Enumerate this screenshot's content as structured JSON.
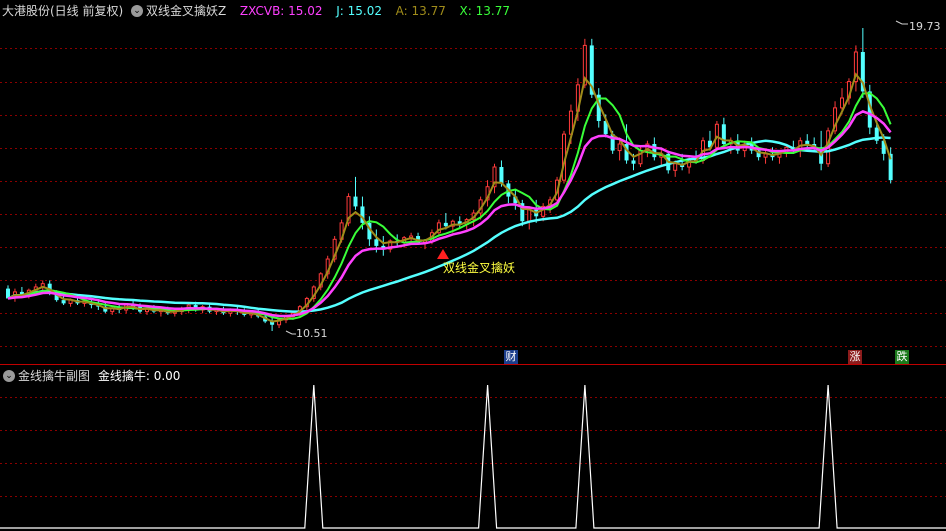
{
  "header": {
    "stock_name": "大港股份(日线 前复权)",
    "indicator_name": "双线金叉擒妖Z",
    "zxcvb_label": "ZXCVB:",
    "zxcvb_value": "15.02",
    "j_label": "J:",
    "j_value": "15.02",
    "a_label": "A:",
    "a_value": "13.77",
    "x_label": "X:",
    "x_value": "13.77",
    "toggle_icon": "chevron-down-icon"
  },
  "sub_header": {
    "indicator_name": "金线擒牛副图",
    "line_label": "金线擒牛:",
    "line_value": "0.00",
    "toggle_icon": "chevron-down-icon"
  },
  "annotations": {
    "high_price": "19.73",
    "low_price": "10.51",
    "signal_text": "双线金叉擒妖",
    "marker_cai": "财",
    "marker_zhang": "涨",
    "marker_die": "跌"
  },
  "colors": {
    "background": "#000000",
    "grid": "#8b0000",
    "up_candle": "#ff3b3b",
    "down_candle": "#54ffff",
    "line_cyan": "#54ffff",
    "line_magenta": "#ff40ff",
    "line_green": "#39ff39",
    "line_olive": "#a08c1a",
    "signal_triangle": "#ff2020",
    "signal_text": "#ffff40",
    "zxcvb": "#ff40ff",
    "j": "#54ffff",
    "a": "#a08c1a",
    "x": "#39ff39",
    "sub_line": "#ffffff"
  },
  "chart_data": {
    "type": "candlestick",
    "price_high": 19.73,
    "price_low": 10.51,
    "candles": [
      [
        11.8,
        11.9,
        11.5,
        11.5
      ],
      [
        11.55,
        11.8,
        11.4,
        11.7
      ],
      [
        11.7,
        11.85,
        11.55,
        11.6
      ],
      [
        11.6,
        11.8,
        11.5,
        11.75
      ],
      [
        11.75,
        11.95,
        11.6,
        11.85
      ],
      [
        11.85,
        12.05,
        11.75,
        11.95
      ],
      [
        11.95,
        12.05,
        11.6,
        11.7
      ],
      [
        11.7,
        11.75,
        11.4,
        11.45
      ],
      [
        11.45,
        11.6,
        11.3,
        11.35
      ],
      [
        11.35,
        11.5,
        11.25,
        11.45
      ],
      [
        11.45,
        11.55,
        11.3,
        11.35
      ],
      [
        11.35,
        11.45,
        11.25,
        11.4
      ],
      [
        11.4,
        11.5,
        11.2,
        11.3
      ],
      [
        11.3,
        11.45,
        11.15,
        11.25
      ],
      [
        11.25,
        11.4,
        11.05,
        11.1
      ],
      [
        11.1,
        11.25,
        11.0,
        11.2
      ],
      [
        11.2,
        11.3,
        11.05,
        11.15
      ],
      [
        11.15,
        11.35,
        11.05,
        11.3
      ],
      [
        11.3,
        11.45,
        11.15,
        11.25
      ],
      [
        11.25,
        11.35,
        11.05,
        11.1
      ],
      [
        11.1,
        11.25,
        11.0,
        11.2
      ],
      [
        11.2,
        11.3,
        11.05,
        11.1
      ],
      [
        11.1,
        11.2,
        10.95,
        11.15
      ],
      [
        11.15,
        11.25,
        11.0,
        11.05
      ],
      [
        11.05,
        11.2,
        10.95,
        11.1
      ],
      [
        11.1,
        11.25,
        11.0,
        11.2
      ],
      [
        11.2,
        11.35,
        11.05,
        11.3
      ],
      [
        11.3,
        11.4,
        11.1,
        11.15
      ],
      [
        11.15,
        11.3,
        11.05,
        11.25
      ],
      [
        11.25,
        11.35,
        11.05,
        11.1
      ],
      [
        11.1,
        11.2,
        11.0,
        11.15
      ],
      [
        11.15,
        11.25,
        11.0,
        11.05
      ],
      [
        11.05,
        11.2,
        10.95,
        11.15
      ],
      [
        11.15,
        11.3,
        11.0,
        11.1
      ],
      [
        11.1,
        11.2,
        10.95,
        11.0
      ],
      [
        11.0,
        11.1,
        10.9,
        11.05
      ],
      [
        11.05,
        11.15,
        10.9,
        10.95
      ],
      [
        10.95,
        11.05,
        10.75,
        10.8
      ],
      [
        10.8,
        10.95,
        10.51,
        10.7
      ],
      [
        10.7,
        10.9,
        10.6,
        10.85
      ],
      [
        10.85,
        11.0,
        10.75,
        10.95
      ],
      [
        10.95,
        11.1,
        10.85,
        11.05
      ],
      [
        11.05,
        11.3,
        10.95,
        11.25
      ],
      [
        11.25,
        11.55,
        11.15,
        11.5
      ],
      [
        11.5,
        11.9,
        11.4,
        11.85
      ],
      [
        11.85,
        12.3,
        11.75,
        12.25
      ],
      [
        12.25,
        12.8,
        12.1,
        12.7
      ],
      [
        12.7,
        13.4,
        12.6,
        13.3
      ],
      [
        13.3,
        13.9,
        13.2,
        13.8
      ],
      [
        13.8,
        14.7,
        13.7,
        14.6
      ],
      [
        14.6,
        15.2,
        14.2,
        14.3
      ],
      [
        14.3,
        14.6,
        13.6,
        13.8
      ],
      [
        13.8,
        14.0,
        13.1,
        13.3
      ],
      [
        13.3,
        13.6,
        12.9,
        13.1
      ],
      [
        13.1,
        13.4,
        12.8,
        13.0
      ],
      [
        13.0,
        13.3,
        12.9,
        13.25
      ],
      [
        13.25,
        13.45,
        13.1,
        13.2
      ],
      [
        13.2,
        13.4,
        13.05,
        13.35
      ],
      [
        13.35,
        13.5,
        13.2,
        13.4
      ],
      [
        13.4,
        13.5,
        13.15,
        13.2
      ],
      [
        13.2,
        13.3,
        13.0,
        13.25
      ],
      [
        13.25,
        13.6,
        13.15,
        13.5
      ],
      [
        13.5,
        13.9,
        13.4,
        13.8
      ],
      [
        13.8,
        14.1,
        13.6,
        13.7
      ],
      [
        13.7,
        13.9,
        13.5,
        13.85
      ],
      [
        13.85,
        14.0,
        13.65,
        13.75
      ],
      [
        13.75,
        13.95,
        13.6,
        13.9
      ],
      [
        13.9,
        14.2,
        13.7,
        14.1
      ],
      [
        14.1,
        14.6,
        13.9,
        14.5
      ],
      [
        14.5,
        15.1,
        14.3,
        14.9
      ],
      [
        14.9,
        15.6,
        14.7,
        15.5
      ],
      [
        15.5,
        15.7,
        14.9,
        15.0
      ],
      [
        15.0,
        15.1,
        14.4,
        14.6
      ],
      [
        14.6,
        14.8,
        14.2,
        14.4
      ],
      [
        14.4,
        14.5,
        13.7,
        13.85
      ],
      [
        13.85,
        14.3,
        13.6,
        14.2
      ],
      [
        14.2,
        14.5,
        13.8,
        14.0
      ],
      [
        14.0,
        14.4,
        13.85,
        14.3
      ],
      [
        14.3,
        14.6,
        14.1,
        14.5
      ],
      [
        14.5,
        15.2,
        14.4,
        15.1
      ],
      [
        15.1,
        16.6,
        15.0,
        16.5
      ],
      [
        16.5,
        17.4,
        16.2,
        17.2
      ],
      [
        17.2,
        18.2,
        16.9,
        18.0
      ],
      [
        18.0,
        19.4,
        17.9,
        19.2
      ],
      [
        19.2,
        19.4,
        17.6,
        17.7
      ],
      [
        17.7,
        17.9,
        16.7,
        16.9
      ],
      [
        16.9,
        17.1,
        16.4,
        16.5
      ],
      [
        16.5,
        16.6,
        15.9,
        16.0
      ],
      [
        16.0,
        16.4,
        15.7,
        16.2
      ],
      [
        16.2,
        16.8,
        15.6,
        15.7
      ],
      [
        15.7,
        15.9,
        15.4,
        15.6
      ],
      [
        15.6,
        16.1,
        15.5,
        16.0
      ],
      [
        16.0,
        16.3,
        15.8,
        16.2
      ],
      [
        16.2,
        16.4,
        15.7,
        15.8
      ],
      [
        15.8,
        16.1,
        15.5,
        15.9
      ],
      [
        15.9,
        16.0,
        15.3,
        15.4
      ],
      [
        15.4,
        15.7,
        15.2,
        15.6
      ],
      [
        15.6,
        15.9,
        15.4,
        15.5
      ],
      [
        15.5,
        15.8,
        15.3,
        15.75
      ],
      [
        15.75,
        16.0,
        15.6,
        15.7
      ],
      [
        15.7,
        16.4,
        15.6,
        16.3
      ],
      [
        16.3,
        16.6,
        16.0,
        16.1
      ],
      [
        16.1,
        16.9,
        16.0,
        16.8
      ],
      [
        16.8,
        17.0,
        16.1,
        16.2
      ],
      [
        16.2,
        16.4,
        15.9,
        16.3
      ],
      [
        16.3,
        16.5,
        15.9,
        16.0
      ],
      [
        16.0,
        16.3,
        15.8,
        16.2
      ],
      [
        16.2,
        16.4,
        15.9,
        16.0
      ],
      [
        16.0,
        16.1,
        15.7,
        15.8
      ],
      [
        15.8,
        16.0,
        15.6,
        15.9
      ],
      [
        15.9,
        16.1,
        15.7,
        15.8
      ],
      [
        15.8,
        16.0,
        15.6,
        15.95
      ],
      [
        15.95,
        16.2,
        15.8,
        16.1
      ],
      [
        16.1,
        16.3,
        15.9,
        16.0
      ],
      [
        16.0,
        16.4,
        15.8,
        16.3
      ],
      [
        16.3,
        16.5,
        16.1,
        16.2
      ],
      [
        16.2,
        16.4,
        16.0,
        16.1
      ],
      [
        16.1,
        16.6,
        15.4,
        15.6
      ],
      [
        15.6,
        16.7,
        15.5,
        16.6
      ],
      [
        16.6,
        17.5,
        16.5,
        17.3
      ],
      [
        17.3,
        17.9,
        17.1,
        17.6
      ],
      [
        17.6,
        18.2,
        17.4,
        18.1
      ],
      [
        18.1,
        19.2,
        17.8,
        19.0
      ],
      [
        19.0,
        19.73,
        17.6,
        17.8
      ],
      [
        17.8,
        18.0,
        16.5,
        16.7
      ],
      [
        16.7,
        16.9,
        16.2,
        16.3
      ],
      [
        16.3,
        16.5,
        15.7,
        15.9
      ],
      [
        15.9,
        16.1,
        15.0,
        15.1
      ]
    ],
    "signal_peaks_bar_index": [
      44,
      69,
      83,
      118
    ]
  }
}
